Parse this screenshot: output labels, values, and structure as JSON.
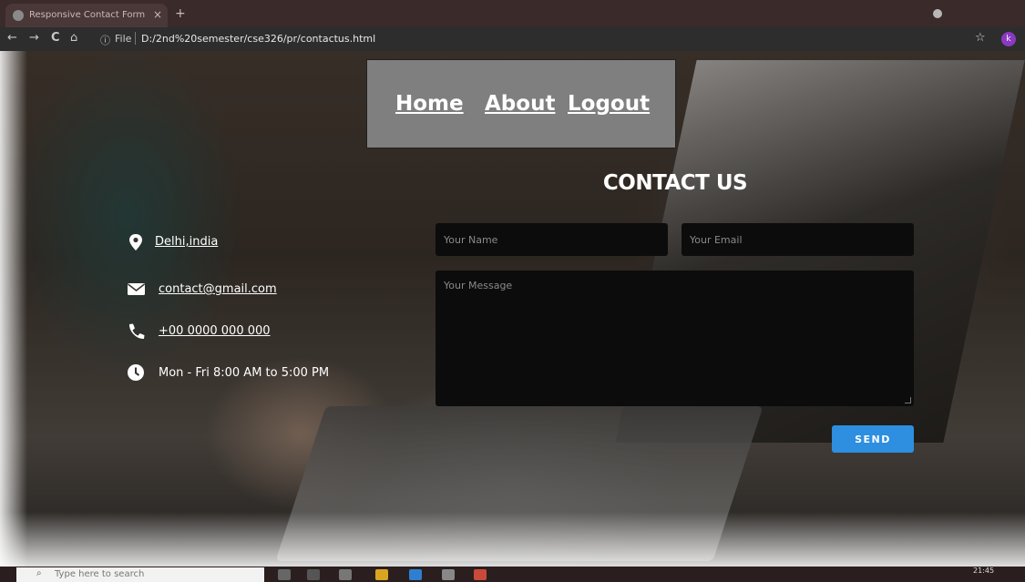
{
  "browser": {
    "tab_title": "Responsive Contact Form",
    "tab_close": "×",
    "new_tab": "+",
    "back": "←",
    "forward": "→",
    "reload": "C",
    "home": "⌂",
    "info_icon": "ⓘ",
    "scheme": "File",
    "url": "D:/2nd%20semester/cse326/pr/contactus.html",
    "star": "☆",
    "profile_initial": "k"
  },
  "nav": {
    "items": [
      {
        "label": "Home"
      },
      {
        "label": "About"
      },
      {
        "label": "Logout"
      }
    ]
  },
  "contact": {
    "title": "CONTACT US",
    "location": "Delhi,india",
    "email": "contact@gmail.com",
    "phone": "+00 0000 000 000",
    "hours": "Mon - Fri 8:00 AM to 5:00 PM"
  },
  "form": {
    "name_placeholder": "Your Name",
    "email_placeholder": "Your Email",
    "message_placeholder": "Your Message",
    "send_label": "SEND"
  },
  "taskbar": {
    "search_placeholder": "Type here to search",
    "time": "21:45"
  },
  "colors": {
    "send_button": "#2e8ee0",
    "nav_bg": "#7f7f7f",
    "field_bg": "#0c0c0c",
    "profile": "#8a39c0"
  }
}
